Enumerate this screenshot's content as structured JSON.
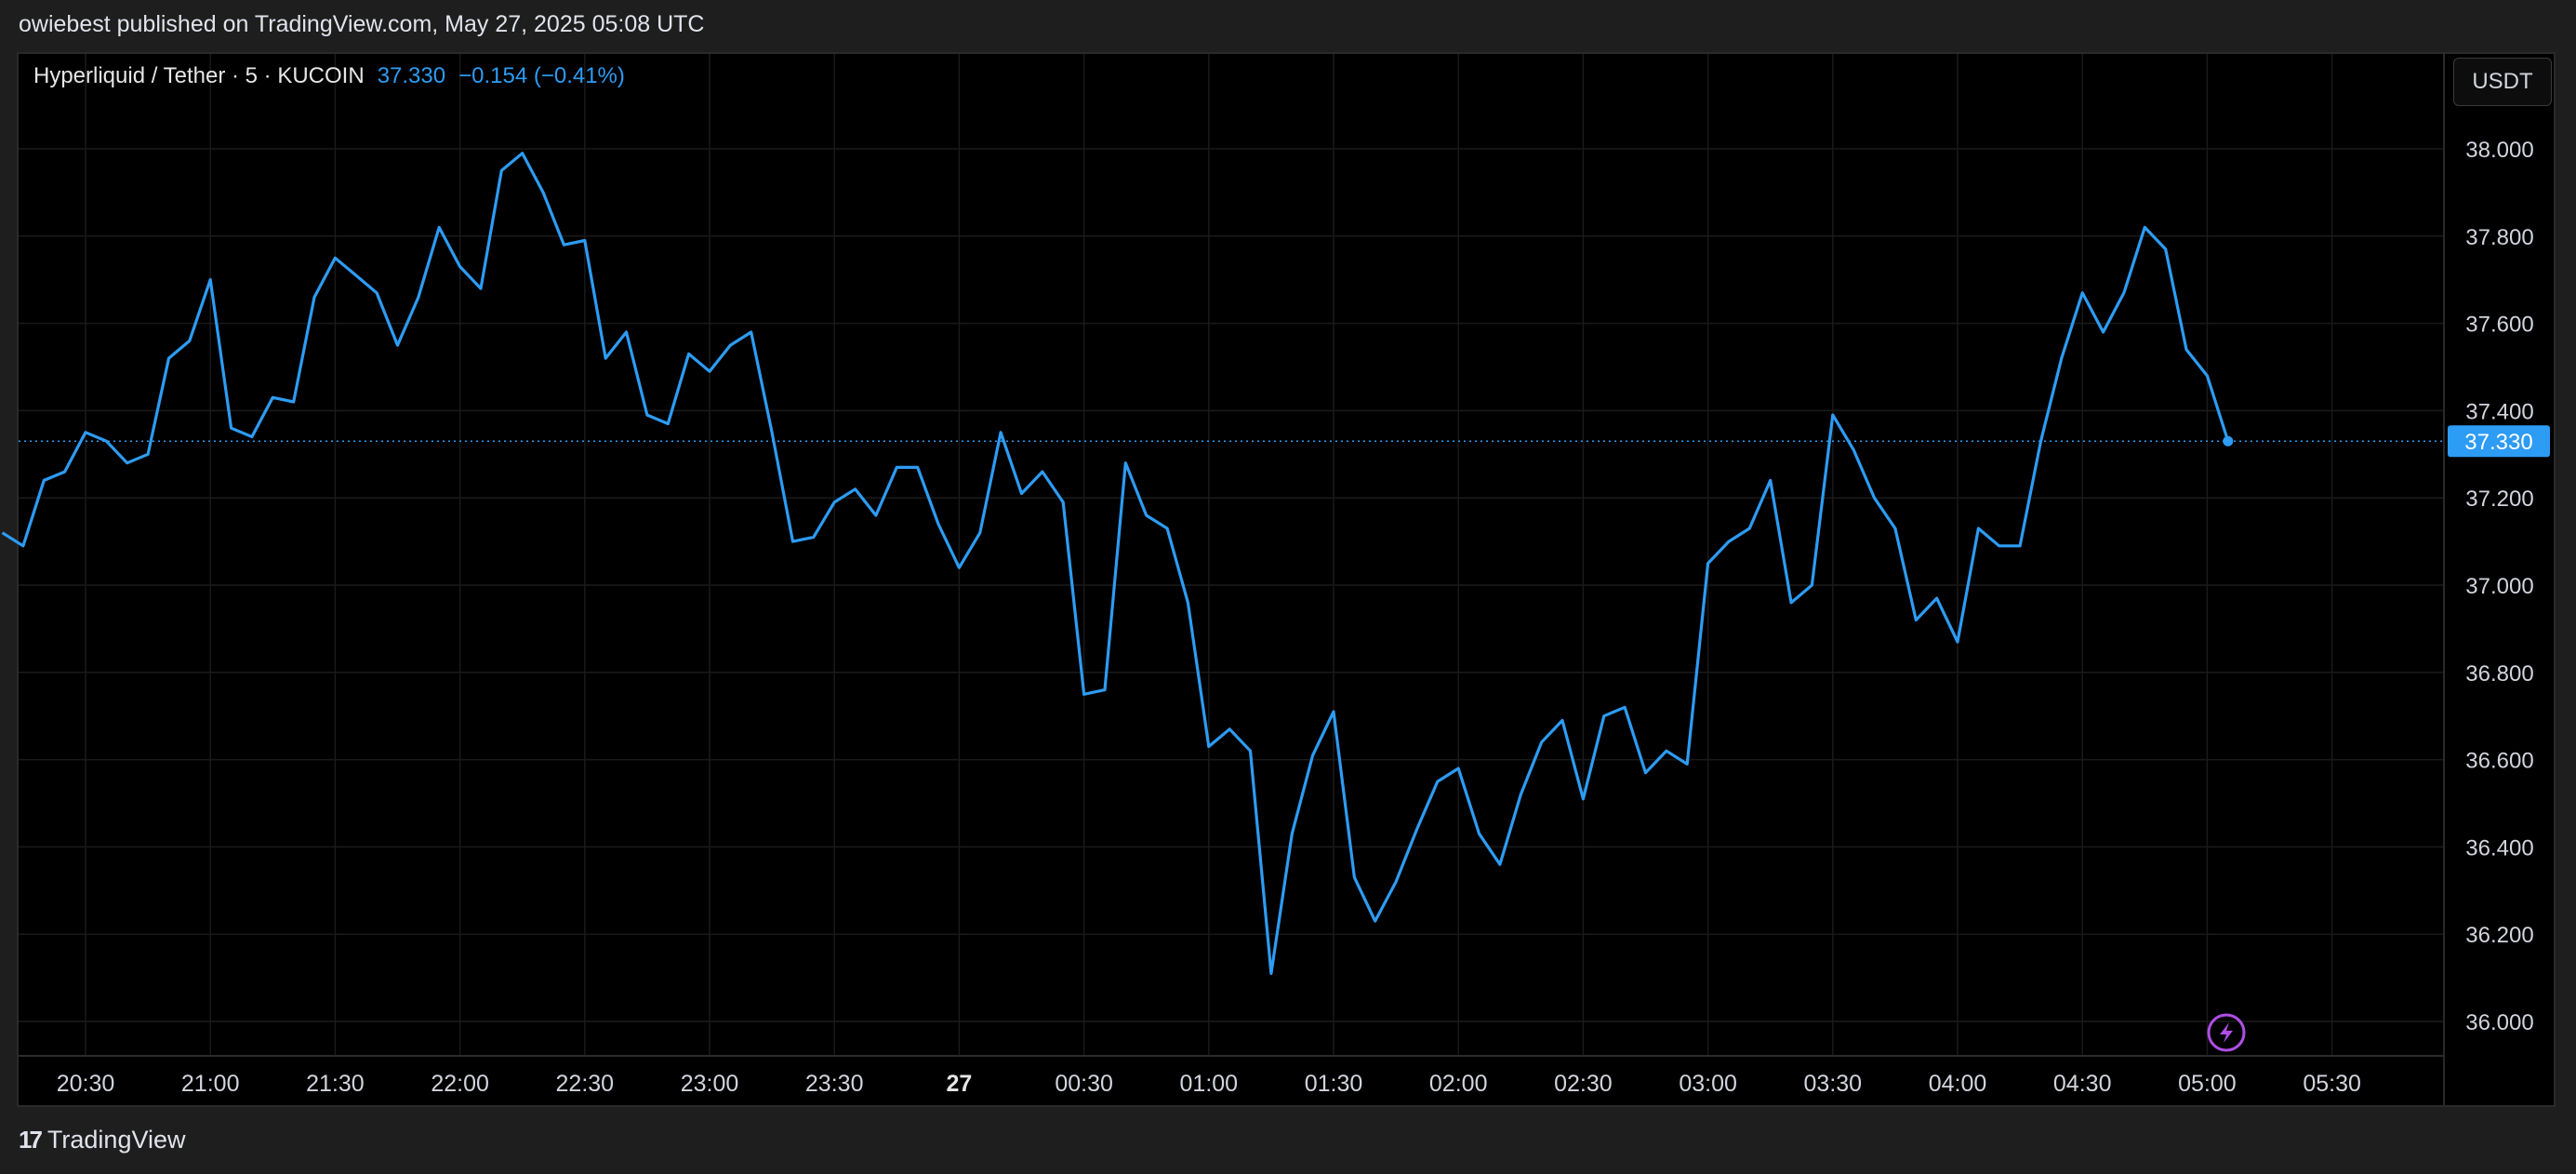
{
  "header": {
    "published": "owiebest published on TradingView.com, May 27, 2025 05:08 UTC"
  },
  "legend": {
    "symbol": "Hyperliquid / Tether · 5 · KUCOIN",
    "last": "37.330",
    "change": "−0.154 (−0.41%)"
  },
  "currency_button": "USDT",
  "last_price_label": "37.330",
  "footer": {
    "brand": "TradingView",
    "logo_icon": "tradingview-logo-icon"
  },
  "colors": {
    "line": "#2d9cf4",
    "background": "#000000",
    "grid": "#1a1a1a",
    "accent_bolt": "#b04ee6"
  },
  "chart_data": {
    "type": "line",
    "x_start": "2025-05-26 20:10",
    "x_step_minutes": 5,
    "y_ticks": [
      "38.000",
      "37.800",
      "37.600",
      "37.400",
      "37.200",
      "37.000",
      "36.800",
      "36.600",
      "36.400",
      "36.200",
      "36.000"
    ],
    "ylim": [
      35.93,
      38.13
    ],
    "x_tick_labels": [
      "20:30",
      "21:00",
      "21:30",
      "22:00",
      "22:30",
      "23:00",
      "23:30",
      "27",
      "00:30",
      "01:00",
      "01:30",
      "02:00",
      "02:30",
      "03:00",
      "03:30",
      "04:00",
      "04:30",
      "05:00",
      "05:30"
    ],
    "last_value": 37.33,
    "values": [
      37.12,
      37.09,
      37.24,
      37.26,
      37.35,
      37.33,
      37.28,
      37.3,
      37.52,
      37.56,
      37.7,
      37.36,
      37.34,
      37.43,
      37.42,
      37.66,
      37.75,
      37.71,
      37.67,
      37.55,
      37.66,
      37.82,
      37.73,
      37.68,
      37.95,
      37.99,
      37.9,
      37.78,
      37.79,
      37.52,
      37.58,
      37.39,
      37.37,
      37.53,
      37.49,
      37.55,
      37.58,
      37.35,
      37.1,
      37.11,
      37.19,
      37.22,
      37.16,
      37.27,
      37.27,
      37.14,
      37.04,
      37.12,
      37.35,
      37.21,
      37.26,
      37.19,
      36.75,
      36.76,
      37.28,
      37.16,
      37.13,
      36.96,
      36.63,
      36.67,
      36.62,
      36.11,
      36.43,
      36.61,
      36.71,
      36.33,
      36.23,
      36.32,
      36.44,
      36.55,
      36.58,
      36.43,
      36.36,
      36.52,
      36.64,
      36.69,
      36.51,
      36.7,
      36.72,
      36.57,
      36.62,
      36.59,
      37.05,
      37.1,
      37.13,
      37.24,
      36.96,
      37.0,
      37.39,
      37.31,
      37.2,
      37.13,
      36.92,
      36.97,
      36.87,
      37.13,
      37.09,
      37.09,
      37.33,
      37.52,
      37.67,
      37.58,
      37.67,
      37.82,
      37.77,
      37.54,
      37.48,
      37.33
    ]
  }
}
